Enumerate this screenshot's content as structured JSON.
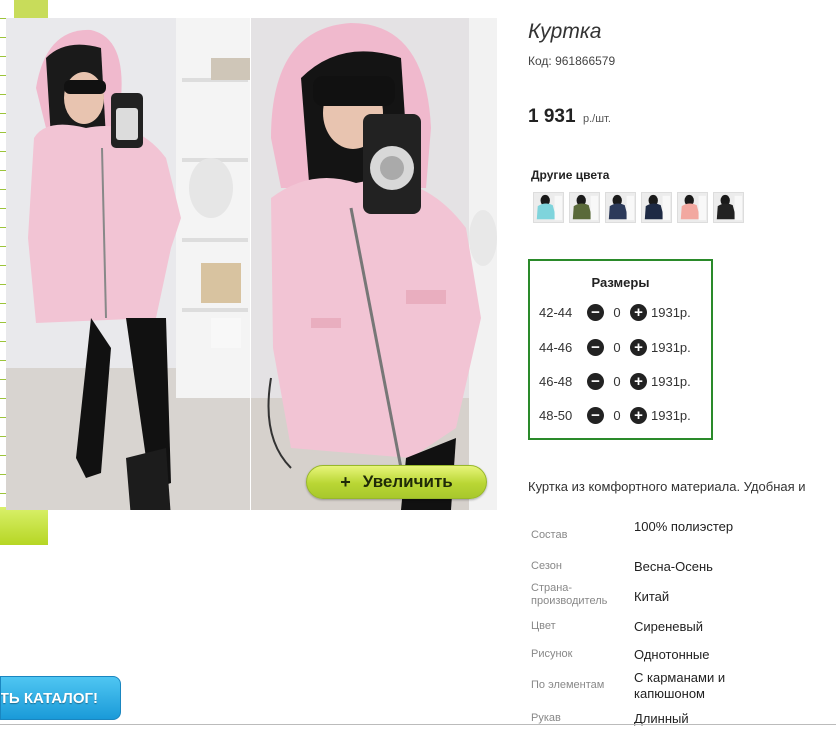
{
  "product": {
    "title": "Куртка",
    "sku": "Код: 961866579",
    "price_amount": "1 931",
    "price_unit": "р./шт."
  },
  "gallery": {
    "zoom_button_icon": "+",
    "zoom_button_label": "Увеличить"
  },
  "catalog_button": {
    "label": "ТЬ КАТАЛОГ!"
  },
  "other_colors": {
    "title": "Другие цвета",
    "swatches": [
      {
        "color": "#7fd4dc"
      },
      {
        "color": "#5a6a3a"
      },
      {
        "color": "#2c3a5a"
      },
      {
        "color": "#1e2a44"
      },
      {
        "color": "#f2a8a0"
      },
      {
        "color": "#222222"
      }
    ]
  },
  "sizes": {
    "title": "Размеры",
    "rows": [
      {
        "size": "42-44",
        "qty": "0",
        "price": "1931р."
      },
      {
        "size": "44-46",
        "qty": "0",
        "price": "1931р."
      },
      {
        "size": "46-48",
        "qty": "0",
        "price": "1931р."
      },
      {
        "size": "48-50",
        "qty": "0",
        "price": "1931р."
      }
    ],
    "minus_icon": "−",
    "plus_icon": "+"
  },
  "description": "Куртка из комфортного материала. Удобная и",
  "properties": [
    {
      "key": "Состав",
      "value": "100% полиэстер"
    },
    {
      "key": "Сезон",
      "value": "Весна-Осень"
    },
    {
      "key": "Страна-производитель",
      "value": "Китай"
    },
    {
      "key": "Цвет",
      "value": "Сиреневый"
    },
    {
      "key": "Рисунок",
      "value": "Однотонные"
    },
    {
      "key": "По элементам",
      "value": "С карманами и капюшоном"
    },
    {
      "key": "Рукав",
      "value": "Длинный"
    }
  ],
  "colors": {
    "accent_green": "#2a8a2a",
    "button_lime": "#b9d634",
    "catalog_blue": "#1a9ad8",
    "jacket_pink": "#f2c4d4"
  }
}
